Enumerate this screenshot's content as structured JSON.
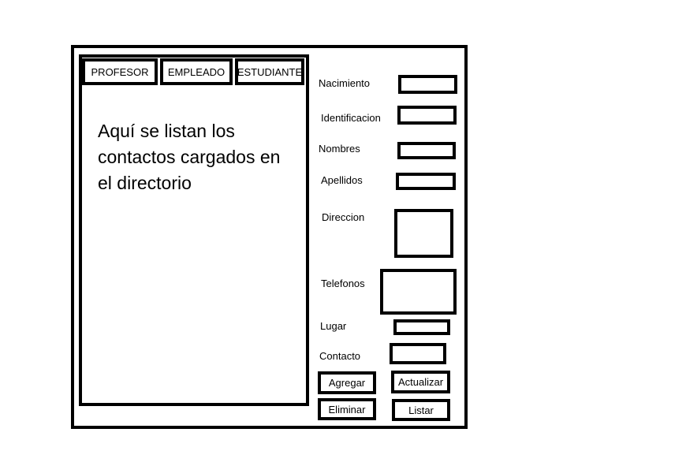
{
  "tabs": [
    {
      "label": "PROFESOR"
    },
    {
      "label": "EMPLEADO"
    },
    {
      "label": "ESTUDIANTE"
    }
  ],
  "list_area": {
    "text": "Aquí se listan los contactos cargados en el directorio"
  },
  "form": {
    "fields": [
      {
        "label": "Nacimiento",
        "value": ""
      },
      {
        "label": "Identificacion",
        "value": ""
      },
      {
        "label": "Nombres",
        "value": ""
      },
      {
        "label": "Apellidos",
        "value": ""
      },
      {
        "label": "Direccion",
        "value": ""
      },
      {
        "label": "Telefonos",
        "value": ""
      },
      {
        "label": "Lugar",
        "value": ""
      },
      {
        "label": "Contacto",
        "value": ""
      }
    ]
  },
  "buttons": {
    "agregar": "Agregar",
    "actualizar": "Actualizar",
    "eliminar": "Eliminar",
    "listar": "Listar"
  }
}
